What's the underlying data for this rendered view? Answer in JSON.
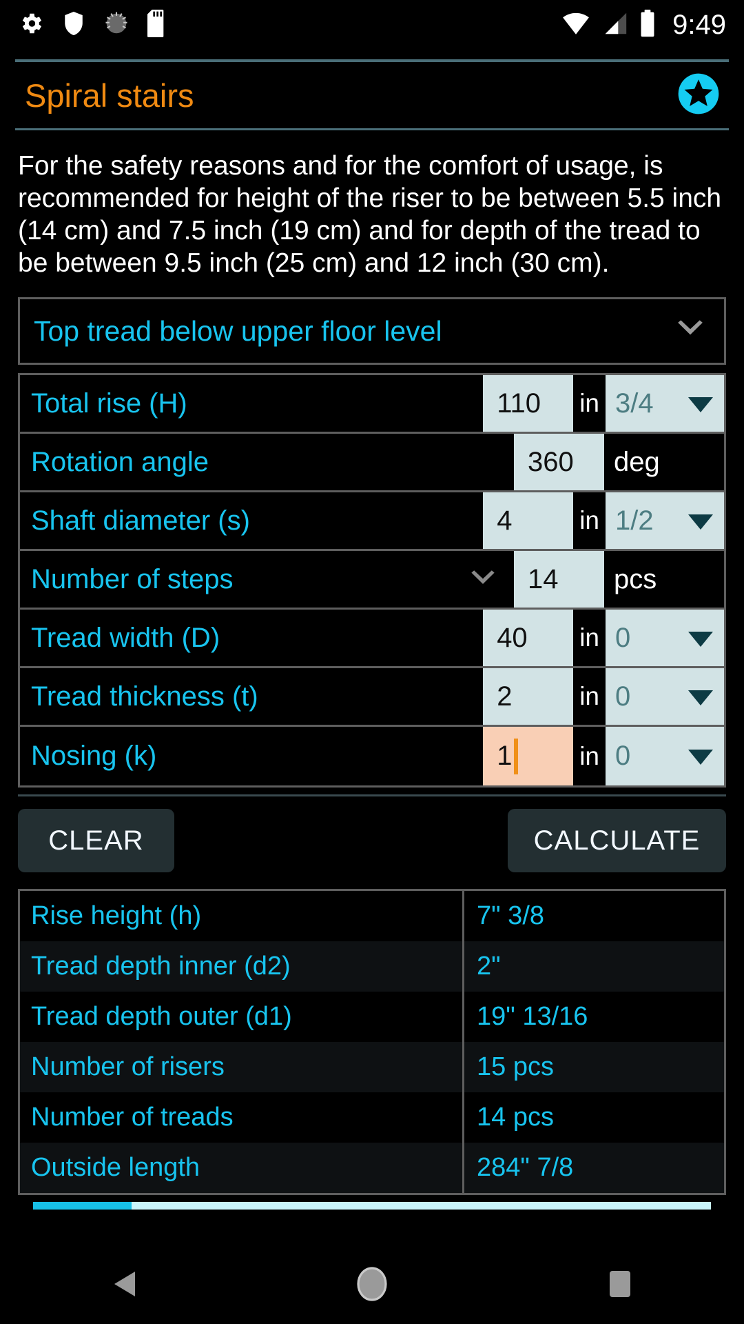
{
  "statusbar": {
    "time": "9:49",
    "left_icons": [
      "gear-icon",
      "shield-icon",
      "loading-circle-icon",
      "sd-card-icon"
    ],
    "right_icons": [
      "wifi-icon",
      "cellular-signal-icon",
      "battery-icon"
    ]
  },
  "header": {
    "title": "Spiral stairs",
    "favorite_icon": "star-icon",
    "accent_color": "#f08a12",
    "rule_color": "#4a6e78"
  },
  "description": "For the safety reasons and for the comfort of usage, is recommended for height of the riser to be between 5.5 inch (14 cm) and 7.5 inch (19 cm) and for depth of the tread to be between 9.5 inch (25 cm) and 12 inch (30 cm).",
  "selector": {
    "value": "Top tread below upper floor level",
    "icon": "chevron-down-icon"
  },
  "inputs": [
    {
      "label": "Total rise (H)",
      "value": "110",
      "unit": "in",
      "fraction": "3/4",
      "has_fraction": true,
      "has_label_chevron": false,
      "focused": false
    },
    {
      "label": "Rotation angle",
      "value": "360",
      "unit": "deg",
      "fraction": "",
      "has_fraction": false,
      "has_label_chevron": false,
      "focused": false
    },
    {
      "label": "Shaft diameter (s)",
      "value": "4",
      "unit": "in",
      "fraction": "1/2",
      "has_fraction": true,
      "has_label_chevron": false,
      "focused": false
    },
    {
      "label": "Number of steps",
      "value": "14",
      "unit": "pcs",
      "fraction": "",
      "has_fraction": false,
      "has_label_chevron": true,
      "focused": false
    },
    {
      "label": "Tread width (D)",
      "value": "40",
      "unit": "in",
      "fraction": "0",
      "has_fraction": true,
      "has_label_chevron": false,
      "focused": false
    },
    {
      "label": "Tread thickness (t)",
      "value": "2",
      "unit": "in",
      "fraction": "0",
      "has_fraction": true,
      "has_label_chevron": false,
      "focused": false
    },
    {
      "label": "Nosing (k)",
      "value": "1",
      "unit": "in",
      "fraction": "0",
      "has_fraction": true,
      "has_label_chevron": false,
      "focused": true
    }
  ],
  "buttons": {
    "clear": "CLEAR",
    "calculate": "CALCULATE"
  },
  "results": [
    {
      "label": "Rise height (h)",
      "value": "7\" 3/8"
    },
    {
      "label": "Tread depth inner (d2)",
      "value": "2\""
    },
    {
      "label": "Tread depth outer (d1)",
      "value": "19\" 13/16"
    },
    {
      "label": "Number of risers",
      "value": "15 pcs"
    },
    {
      "label": "Number of treads",
      "value": "14 pcs"
    },
    {
      "label": "Outside length",
      "value": "284\" 7/8"
    }
  ],
  "scrollbar": {
    "thumb_color": "#17c0e8",
    "track_color": "#c8f4fb",
    "thumb_percent": "14.5"
  },
  "navbar": {
    "back": "back-triangle-icon",
    "home": "home-circle-icon",
    "recents": "recents-square-icon"
  },
  "colors": {
    "accent_cyan": "#18c4ef",
    "title_orange": "#f08a12",
    "field_bg": "#d2e3e5",
    "field_focus_bg": "#f9cfb5",
    "caret": "#f09018",
    "border": "#5e5e5e"
  }
}
